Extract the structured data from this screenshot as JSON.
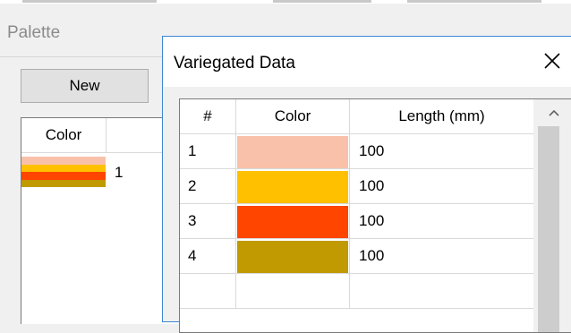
{
  "palette": {
    "title": "Palette",
    "new_button": "New",
    "table": {
      "headers": [
        "Color",
        ""
      ],
      "rows": [
        {
          "number": "1",
          "colors": [
            "#f9c1a9",
            "#ffc000",
            "#ff4500",
            "#c09a00"
          ]
        }
      ]
    }
  },
  "dialog": {
    "title": "Variegated Data",
    "close_icon": "close-icon",
    "headers": {
      "index": "#",
      "color": "Color",
      "length": "Length (mm)"
    },
    "rows": [
      {
        "index": "1",
        "color": "#f9c1a9",
        "length": "100"
      },
      {
        "index": "2",
        "color": "#ffc000",
        "length": "100"
      },
      {
        "index": "3",
        "color": "#ff4500",
        "length": "100"
      },
      {
        "index": "4",
        "color": "#c09a00",
        "length": "100"
      },
      {
        "index": "",
        "color": "",
        "length": ""
      }
    ]
  }
}
